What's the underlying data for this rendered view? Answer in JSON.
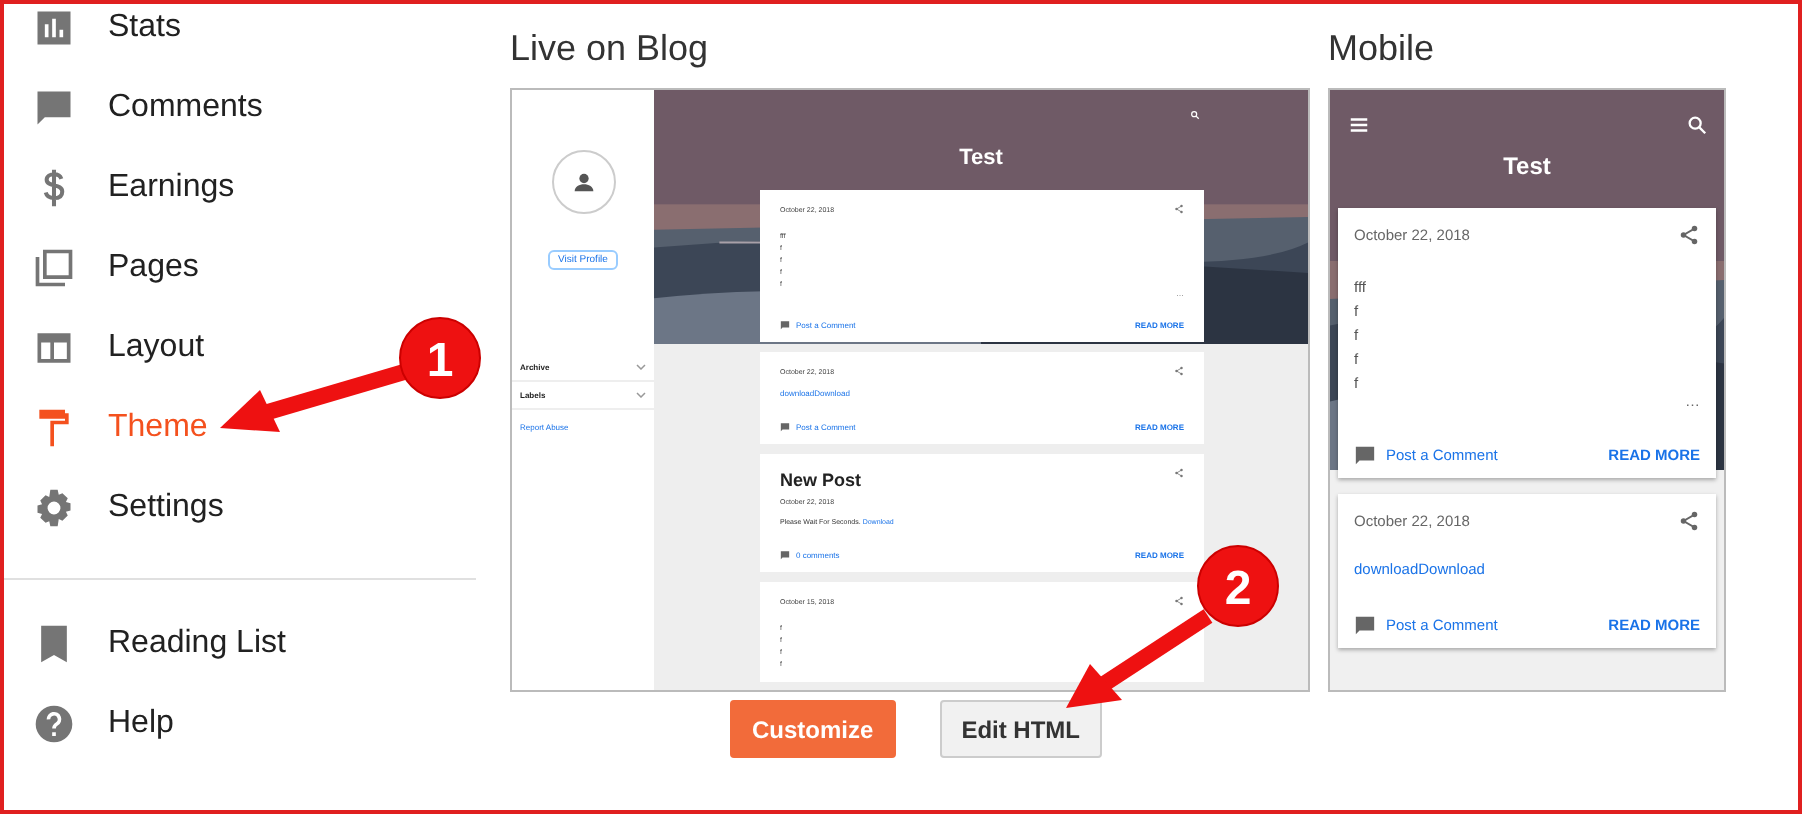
{
  "sidebar": {
    "items": [
      {
        "label": "Stats",
        "selected": false
      },
      {
        "label": "Comments",
        "selected": false
      },
      {
        "label": "Earnings",
        "selected": false
      },
      {
        "label": "Pages",
        "selected": false
      },
      {
        "label": "Layout",
        "selected": false
      },
      {
        "label": "Theme",
        "selected": true
      },
      {
        "label": "Settings",
        "selected": false
      }
    ],
    "bottom_items": [
      {
        "label": "Reading List",
        "selected": false
      },
      {
        "label": "Help",
        "selected": false
      }
    ]
  },
  "live": {
    "heading": "Live on Blog",
    "title": "Test",
    "visit_profile": "Visit Profile",
    "widgets": [
      "Archive",
      "Labels"
    ],
    "report": "Report Abuse",
    "posts": [
      {
        "date": "October 22, 2018",
        "lines": [
          "fff",
          "f",
          "f",
          "f",
          "f"
        ],
        "more": "…",
        "comment": "Post a Comment",
        "read": "READ MORE"
      },
      {
        "date": "October 22, 2018",
        "link": "downloadDownload",
        "comment": "Post a Comment",
        "read": "READ MORE"
      },
      {
        "title": "New Post",
        "date": "October 22, 2018",
        "body": "Please Wait For Seconds.",
        "link": "Download",
        "comment": "0 comments",
        "read": "READ MORE"
      },
      {
        "date": "October 15, 2018",
        "lines": [
          "f",
          "f",
          "f",
          "f"
        ]
      }
    ]
  },
  "mobile": {
    "heading": "Mobile",
    "title": "Test",
    "posts": [
      {
        "date": "October 22, 2018",
        "lines": [
          "fff",
          "f",
          "f",
          "f",
          "f"
        ],
        "more": "…",
        "comment": "Post a Comment",
        "read": "READ MORE"
      },
      {
        "date": "October 22, 2018",
        "link": "downloadDownload",
        "comment": "Post a Comment",
        "read": "READ MORE"
      }
    ]
  },
  "buttons": [
    {
      "label": "Customize",
      "kind": "primary"
    },
    {
      "label": "Edit HTML",
      "kind": "secondary"
    }
  ],
  "annotations": [
    {
      "label": "1"
    },
    {
      "label": "2"
    }
  ]
}
